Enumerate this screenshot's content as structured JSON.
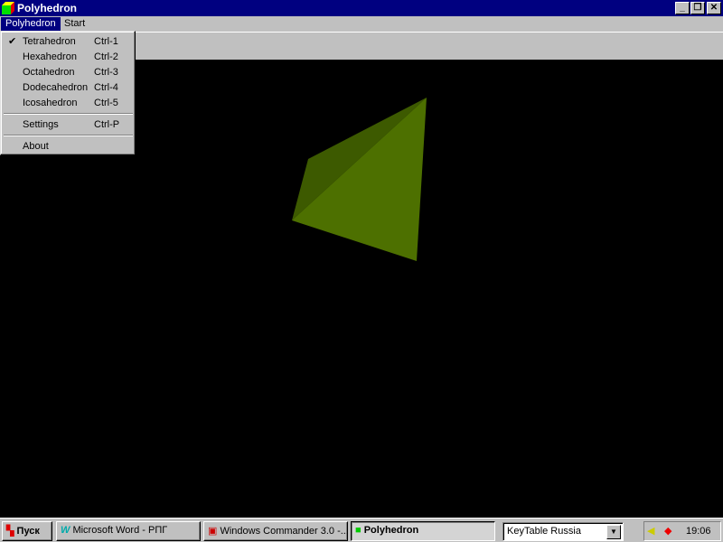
{
  "window": {
    "title": "Polyhedron",
    "icon": "cube-icon"
  },
  "menubar": {
    "items": [
      {
        "label": "Polyhedron",
        "selected": true
      },
      {
        "label": "Start"
      }
    ]
  },
  "dropdown": {
    "items": [
      {
        "label": "Tetrahedron",
        "shortcut": "Ctrl-1",
        "checked": true
      },
      {
        "label": "Hexahedron",
        "shortcut": "Ctrl-2"
      },
      {
        "label": "Octahedron",
        "shortcut": "Ctrl-3"
      },
      {
        "label": "Dodecahedron",
        "shortcut": "Ctrl-4"
      },
      {
        "label": "Icosahedron",
        "shortcut": "Ctrl-5"
      }
    ],
    "settings": {
      "label": "Settings",
      "shortcut": "Ctrl-P"
    },
    "about": {
      "label": "About"
    },
    "check": "✔"
  },
  "scene": {
    "shape": "tetrahedron",
    "colors": {
      "lit_face": "#4d7000",
      "shaded_face": "#3d5a00",
      "background": "#000000"
    }
  },
  "taskbar": {
    "start": "Пуск",
    "buttons": [
      {
        "label": "Microsoft Word - РПГ"
      },
      {
        "label": "Windows Commander 3.0 -..."
      },
      {
        "label": "Polyhedron",
        "active": true
      }
    ],
    "keytable": "KeyTable Russia",
    "clock": "19:06"
  }
}
